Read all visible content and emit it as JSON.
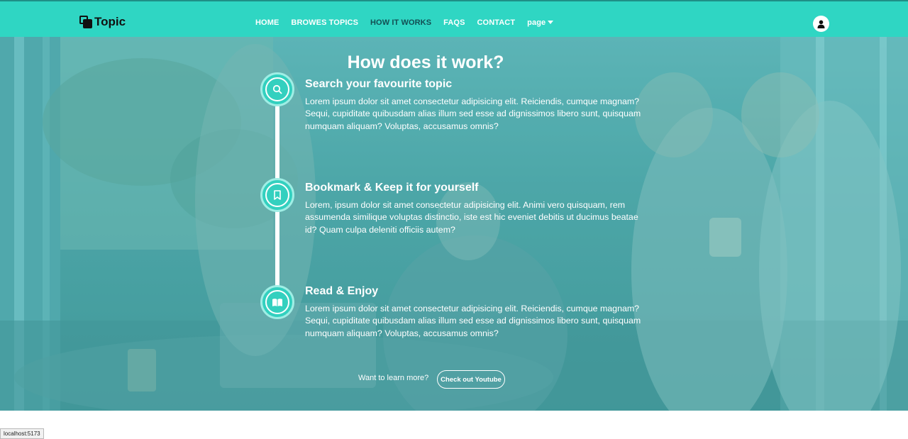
{
  "brand": {
    "name": "Topic"
  },
  "nav": {
    "items": [
      {
        "label": "HOME",
        "active": false
      },
      {
        "label": "BROWES TOPICS",
        "active": false
      },
      {
        "label": "HOW IT WORKS",
        "active": true
      },
      {
        "label": "FAQS",
        "active": false
      },
      {
        "label": "CONTACT",
        "active": false
      }
    ],
    "dropdown_label": "page"
  },
  "section": {
    "title": "How does it work?",
    "steps": [
      {
        "title": "Search your favourite topic",
        "description": "Lorem ipsum dolor sit amet consectetur adipisicing elit. Reiciendis, cumque magnam? Sequi, cupiditate quibusdam alias illum sed esse ad dignissimos libero sunt, quisquam numquam aliquam? Voluptas, accusamus omnis?",
        "icon": "search-icon"
      },
      {
        "title": "Bookmark & Keep it for yourself",
        "description": "Lorem, ipsum dolor sit amet consectetur adipisicing elit. Animi vero quisquam, rem assumenda similique voluptas distinctio, iste est hic eveniet debitis ut ducimus beatae id? Quam culpa deleniti officiis autem?",
        "icon": "bookmark-icon"
      },
      {
        "title": "Read & Enjoy",
        "description": "Lorem ipsum dolor sit amet consectetur adipisicing elit. Reiciendis, cumque magnam? Sequi, cupiditate quibusdam alias illum sed esse ad dignissimos libero sunt, quisquam numquam aliquam? Voluptas, accusamus omnis?",
        "icon": "book-open-icon"
      }
    ],
    "learn_more_text": "Want to learn more?",
    "youtube_button": "Check out Youtube"
  },
  "status_bar": {
    "url": "localhost:5173"
  },
  "colors": {
    "navbar": "#2fd6c3",
    "accent": "#33d0bf",
    "active_nav": "#134e53",
    "text_light": "#ffffff"
  }
}
